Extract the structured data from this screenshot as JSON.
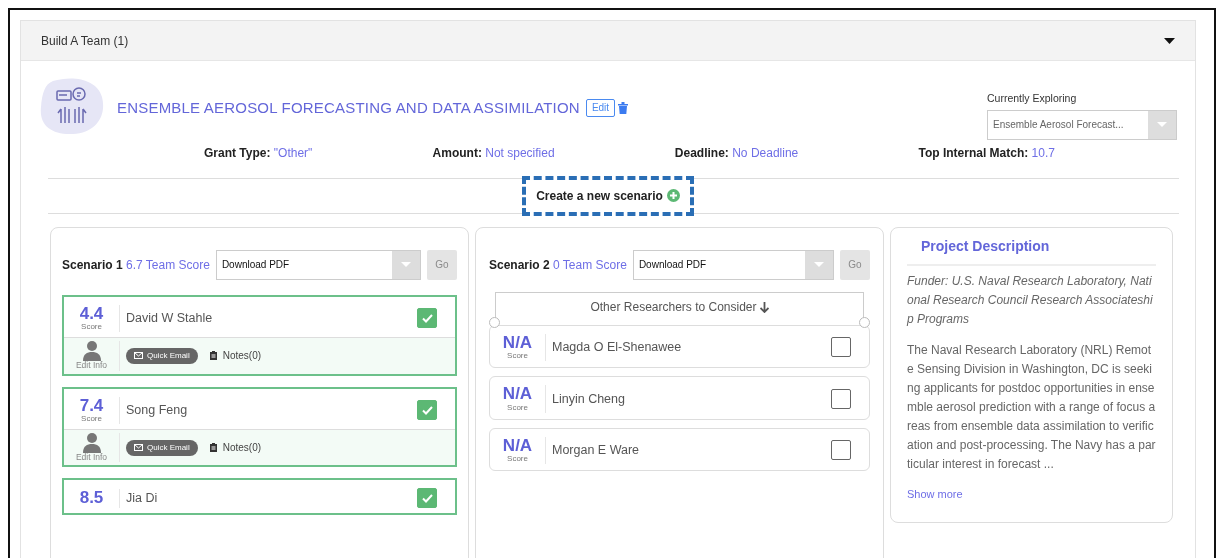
{
  "section": {
    "title": "Build A Team (1)",
    "expanded": true
  },
  "project": {
    "title": "ENSEMBLE AEROSOL FORECASTING AND DATA ASSIMILATION",
    "edit_label": "Edit",
    "exploring_label": "Currently Exploring",
    "exploring_value": "Ensemble Aerosol Forecast...",
    "facts": [
      {
        "label": "Grant Type:",
        "value": "\"Other\""
      },
      {
        "label": "Amount:",
        "value": "Not specified"
      },
      {
        "label": "Deadline:",
        "value": "No Deadline"
      },
      {
        "label": "Top Internal Match:",
        "value": "10.7"
      }
    ]
  },
  "create_scenario": "Create a new scenario",
  "scenarios": [
    {
      "title": "Scenario 1",
      "team_score": "6.7 Team Score",
      "export": "Download PDF",
      "go": {
        "label": "Go",
        "disabled": true
      },
      "members": [
        {
          "score": "4.4",
          "score_label": "Score",
          "name": "David W Stahle",
          "checked": true,
          "details": {
            "edit_info": "Edit Info",
            "email": "Quick Email",
            "notes": "Notes(0)"
          }
        },
        {
          "score": "7.4",
          "score_label": "Score",
          "name": "Song Feng",
          "checked": true,
          "details": {
            "edit_info": "Edit Info",
            "email": "Quick Email",
            "notes": "Notes(0)"
          }
        },
        {
          "score": "8.5",
          "name": "Jia Di",
          "checked": true
        }
      ]
    },
    {
      "title": "Scenario 2",
      "team_score": "0 Team Score",
      "export": "Download PDF",
      "go": {
        "label": "Go",
        "disabled": true
      },
      "suggestions_heading": "Other Researchers to Consider",
      "members": [
        {
          "score": "N/A",
          "score_label": "Score",
          "name": "Magda O El-Shenawee",
          "checked": false
        },
        {
          "score": "N/A",
          "score_label": "Score",
          "name": "Linyin Cheng",
          "checked": false
        },
        {
          "score": "N/A",
          "score_label": "Score",
          "name": "Morgan E Ware",
          "checked": false
        }
      ]
    }
  ],
  "description": {
    "title": "Project Description",
    "funder": "Funder: U.S. Naval Research Laboratory, National Research Council Research Associateship Programs",
    "body": "The Naval Research Laboratory (NRL) Remote Sensing Division in Washington, DC is seeking applicants for postdoc opportunities in ensemble aerosol prediction with a range of focus areas from ensemble data assimilation to verification and post-processing. The Navy has a particular interest in forecast ...",
    "more": "Show more"
  }
}
